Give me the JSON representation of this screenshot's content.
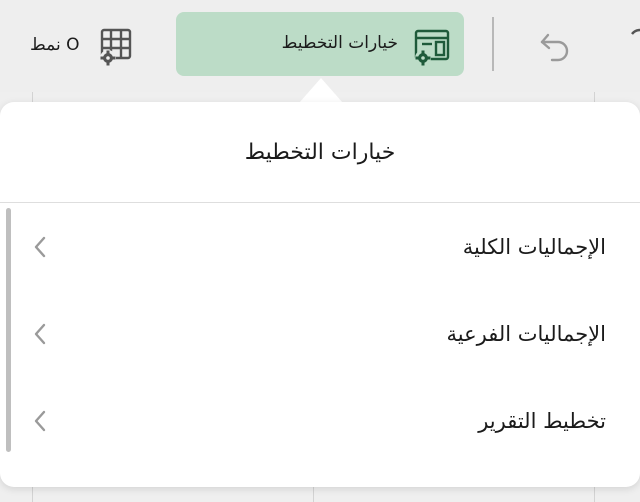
{
  "toolbar": {
    "style_button_label": "نمط O",
    "layout_button_label": "خيارات التخطيط"
  },
  "popover": {
    "title": "خيارات التخطيط",
    "items": [
      {
        "label": "الإجماليات الكلية"
      },
      {
        "label": "الإجماليات الفرعية"
      },
      {
        "label": "تخطيط التقرير"
      }
    ]
  },
  "colors": {
    "accent_bg": "#bcdcc7",
    "icon_green": "#1e5a3a",
    "icon_gray": "#555555"
  }
}
